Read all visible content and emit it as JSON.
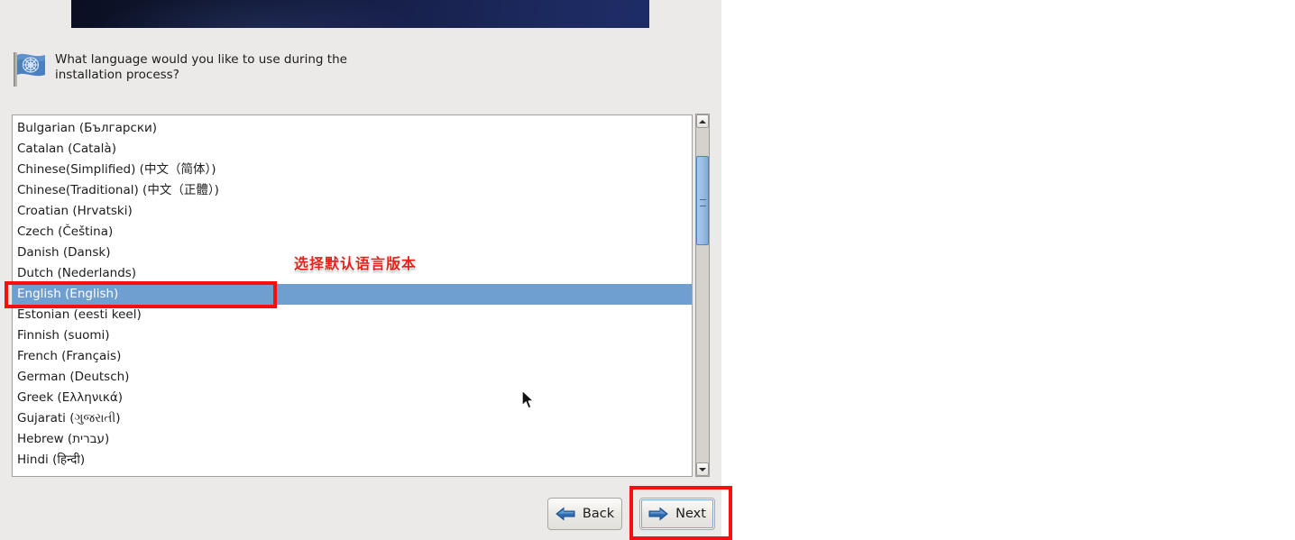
{
  "window": {
    "background_color": "#ebeae8",
    "banner_gradient_from": "#0a0f22",
    "banner_gradient_to": "#1e2c66"
  },
  "prompt": {
    "icon": "flag-icon",
    "text": "What language would you like to use during the installation process?"
  },
  "language_list": {
    "selected_index": 8,
    "selection_color": "#6f9ed0",
    "items": [
      "Bulgarian (Български)",
      "Catalan (Català)",
      "Chinese(Simplified) (中文（简体）)",
      "Chinese(Traditional) (中文（正體）)",
      "Croatian (Hrvatski)",
      "Czech (Čeština)",
      "Danish (Dansk)",
      "Dutch (Nederlands)",
      "English (English)",
      "Estonian (eesti keel)",
      "Finnish (suomi)",
      "French (Français)",
      "German (Deutsch)",
      "Greek (Ελληνικά)",
      "Gujarati (ગુજરાતી)",
      "Hebrew (עברית)",
      "Hindi (हिन्दी)"
    ]
  },
  "scrollbar": {
    "up_icon": "chevron-up-icon",
    "down_icon": "chevron-down-icon",
    "thumb_color": "#9dc0e6"
  },
  "buttons": {
    "back": {
      "label": "Back",
      "icon": "arrow-left-icon"
    },
    "next": {
      "label": "Next",
      "icon": "arrow-right-icon",
      "focused": true
    }
  },
  "annotations": {
    "callout_text": "选择默认语言版本",
    "callout_color": "#e8201a",
    "box_color": "#fc0d0d"
  }
}
